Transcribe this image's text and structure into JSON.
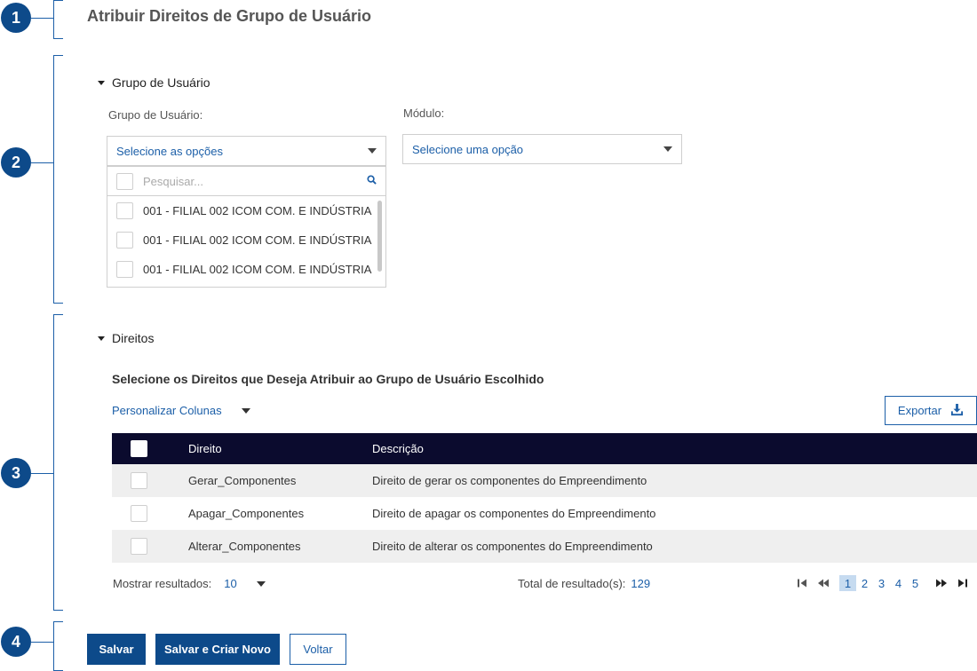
{
  "markers": [
    "1",
    "2",
    "3",
    "4"
  ],
  "page_title": "Atribuir Direitos de Grupo de Usuário",
  "group_section": {
    "heading": "Grupo de Usuário",
    "group_label": "Grupo de Usuário:",
    "group_select_value": "Selecione as opções",
    "module_label": "Módulo:",
    "module_select_value": "Selecione uma opção",
    "search_placeholder": "Pesquisar...",
    "options": [
      "001 - FILIAL 002 ICOM COM. E INDÚSTRIA",
      "001 - FILIAL 002 ICOM COM. E INDÚSTRIA",
      "001 - FILIAL 002 ICOM COM. E INDÚSTRIA"
    ]
  },
  "rights_section": {
    "heading": "Direitos",
    "subtitle": "Selecione os Direitos que Deseja Atribuir ao Grupo de Usuário Escolhido",
    "personalize_label": "Personalizar Colunas",
    "export_label": "Exportar",
    "columns": [
      "Direito",
      "Descrição"
    ],
    "rows": [
      {
        "direito": "Gerar_Componentes",
        "descricao": "Direito de gerar os componentes do Empreendimento"
      },
      {
        "direito": "Apagar_Componentes",
        "descricao": "Direito de apagar os componentes do Empreendimento"
      },
      {
        "direito": "Alterar_Componentes",
        "descricao": "Direito de alterar os componentes do Empreendimento"
      }
    ]
  },
  "pagination": {
    "show_results_label": "Mostrar resultados:",
    "show_results_value": "10",
    "total_label": "Total de resultado(s):",
    "total_value": "129",
    "pages": [
      "1",
      "2",
      "3",
      "4",
      "5"
    ],
    "active_page": "1"
  },
  "actions": {
    "save": "Salvar",
    "save_new": "Salvar e Criar Novo",
    "back": "Voltar"
  },
  "colors": {
    "primary": "#0d4a8a",
    "link": "#1c5fa8",
    "table_header": "#0b0b2e"
  }
}
